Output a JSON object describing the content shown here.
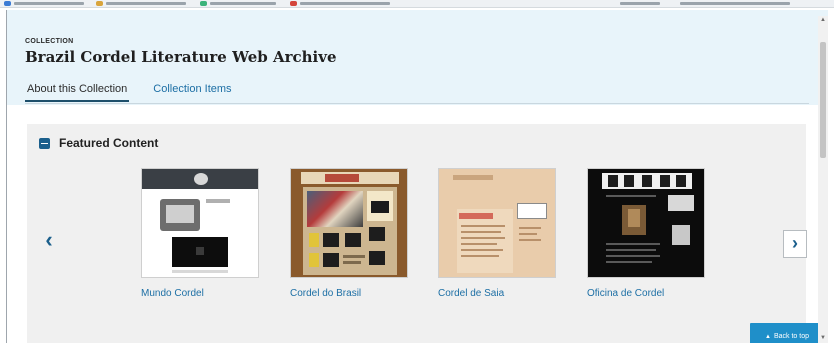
{
  "collection": {
    "eyebrow": "COLLECTION",
    "title": "Brazil Cordel Literature Web Archive"
  },
  "tabs": [
    {
      "label": "About this Collection",
      "active": true
    },
    {
      "label": "Collection Items",
      "active": false
    }
  ],
  "featured": {
    "title": "Featured Content",
    "toggle_icon": "minus-square-icon",
    "prev_icon": "chevron-left-icon",
    "next_icon": "chevron-right-icon",
    "items": [
      {
        "label": "Mundo Cordel"
      },
      {
        "label": "Cordel do Brasil"
      },
      {
        "label": "Cordel de Saia"
      },
      {
        "label": "Oficina de Cordel"
      }
    ]
  },
  "back_to_top": {
    "label": "Back to top",
    "icon": "arrow-up-icon"
  },
  "colors": {
    "header_bg": "#e8f4fa",
    "accent": "#1b5f8c",
    "link": "#1d6fa5",
    "panel_bg": "#f0f0f0",
    "back_to_top_bg": "#1f8fc9"
  }
}
